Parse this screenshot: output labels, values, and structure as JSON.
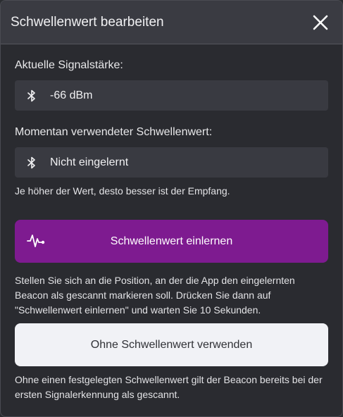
{
  "dialog": {
    "title": "Schwellenwert bearbeiten",
    "close_icon": "close-icon"
  },
  "current_signal": {
    "label": "Aktuelle Signalstärke:",
    "value": "-66 dBm",
    "icon": "bluetooth-icon"
  },
  "threshold": {
    "label": "Momentan verwendeter Schwellenwert:",
    "value": "Nicht eingelernt",
    "icon": "bluetooth-icon",
    "hint": "Je höher der Wert, desto besser ist der Empfang."
  },
  "learn_button": {
    "label": "Schwellenwert einlernen",
    "icon": "pulse-icon",
    "color": "#7e1b90"
  },
  "learn_hint": "Stellen Sie sich an die Position, an der die App den eingelernten Beacon als gescannt markieren soll. Drücken Sie dann auf \"Schwellenwert einlernen\" und warten Sie 10 Sekunden.",
  "no_threshold_button": {
    "label": "Ohne Schwellenwert verwenden"
  },
  "no_threshold_hint": "Ohne einen festgelegten Schwellenwert gilt der Beacon bereits bei der ersten Signalerkennung als gescannt."
}
